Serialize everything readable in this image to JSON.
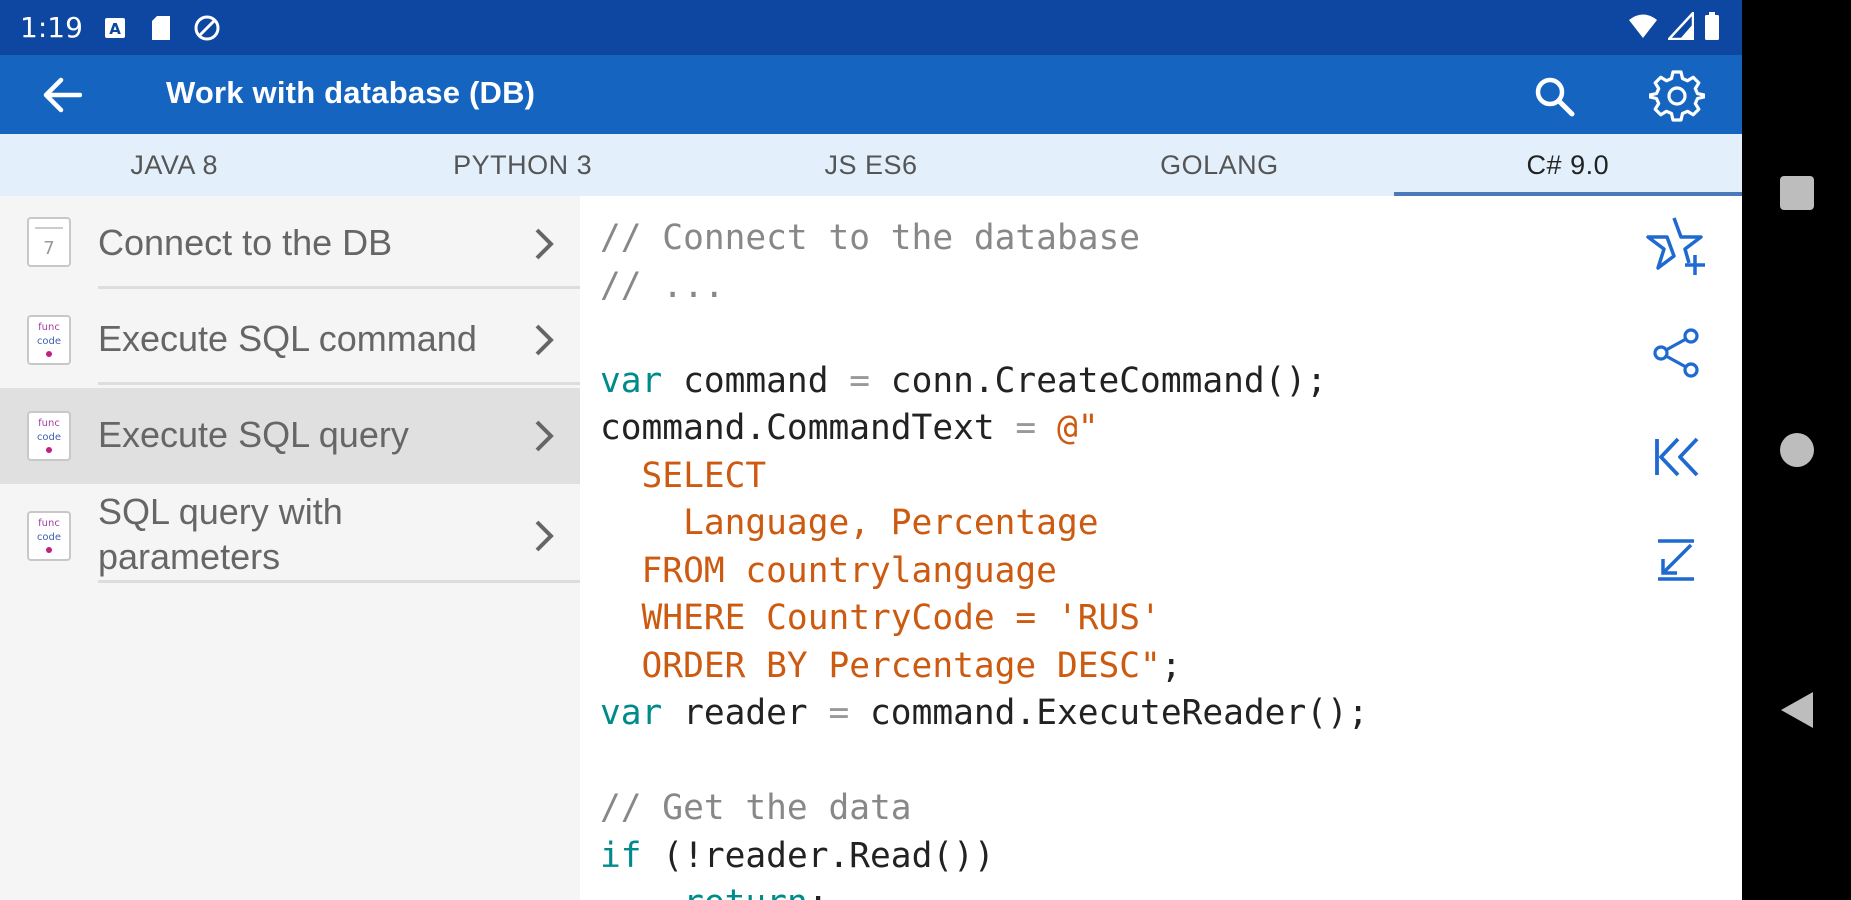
{
  "status_bar": {
    "time": "1:19",
    "icons": [
      "a-notification-icon",
      "sd-card-icon",
      "do-not-disturb-icon",
      "wifi-icon",
      "signal-icon",
      "battery-icon"
    ]
  },
  "app_bar": {
    "title": "Work with database (DB)",
    "icons": [
      "back-arrow-icon",
      "search-icon",
      "gear-icon"
    ]
  },
  "tabs": [
    {
      "label": "JAVA 8",
      "active": false
    },
    {
      "label": "PYTHON 3",
      "active": false
    },
    {
      "label": "JS ES6",
      "active": false
    },
    {
      "label": "GOLANG",
      "active": false
    },
    {
      "label": "C# 9.0",
      "active": true
    }
  ],
  "list": {
    "items": [
      {
        "label": "Connect to the DB",
        "icon": "document-icon",
        "selected": false
      },
      {
        "label": "Execute SQL command",
        "icon": "code-document-icon",
        "selected": false
      },
      {
        "label": "Execute SQL query",
        "icon": "code-document-icon",
        "selected": true
      },
      {
        "label": "SQL query with parameters",
        "icon": "code-document-icon",
        "selected": false
      }
    ]
  },
  "code": {
    "language": "C# 9.0",
    "lines": [
      [
        {
          "t": "// Connect to the database",
          "c": "comment"
        }
      ],
      [
        {
          "t": "// ...",
          "c": "comment"
        }
      ],
      [],
      [
        {
          "t": "var",
          "c": "kw"
        },
        {
          "t": " command ",
          "c": "plain"
        },
        {
          "t": "=",
          "c": "op"
        },
        {
          "t": " conn.CreateCommand();",
          "c": "plain"
        }
      ],
      [
        {
          "t": "command.CommandText ",
          "c": "plain"
        },
        {
          "t": "=",
          "c": "op"
        },
        {
          "t": " ",
          "c": "plain"
        },
        {
          "t": "@\"",
          "c": "str"
        }
      ],
      [
        {
          "t": "  SELECT",
          "c": "str"
        }
      ],
      [
        {
          "t": "    Language, Percentage",
          "c": "str"
        }
      ],
      [
        {
          "t": "  FROM countrylanguage",
          "c": "str"
        }
      ],
      [
        {
          "t": "  WHERE CountryCode = 'RUS'",
          "c": "str"
        }
      ],
      [
        {
          "t": "  ORDER BY Percentage DESC\"",
          "c": "str"
        },
        {
          "t": ";",
          "c": "plain"
        }
      ],
      [
        {
          "t": "var",
          "c": "kw"
        },
        {
          "t": " reader ",
          "c": "plain"
        },
        {
          "t": "=",
          "c": "op"
        },
        {
          "t": " command.ExecuteReader();",
          "c": "plain"
        }
      ],
      [],
      [
        {
          "t": "// Get the data",
          "c": "comment"
        }
      ],
      [
        {
          "t": "if",
          "c": "kw"
        },
        {
          "t": " (!reader.Read())",
          "c": "plain"
        }
      ],
      [
        {
          "t": "    ",
          "c": "plain"
        },
        {
          "t": "return",
          "c": "kw"
        },
        {
          "t": ";",
          "c": "plain"
        }
      ]
    ]
  },
  "side_actions": [
    "star-add-icon",
    "share-icon",
    "skip-to-start-icon",
    "collapse-down-icon"
  ],
  "nav_bar": [
    "overview-square-icon",
    "home-circle-icon",
    "back-triangle-icon"
  ],
  "colors": {
    "status_bar": "#0d47a1",
    "app_bar": "#1565c0",
    "tab_bar": "#e3f0fc",
    "accent_icon": "#1565c0",
    "code_keyword": "#008b8b",
    "code_string": "#cc5a10",
    "code_comment": "#888888"
  }
}
